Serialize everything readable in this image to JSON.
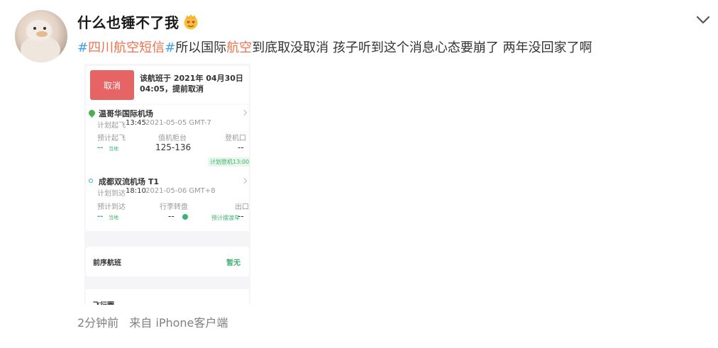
{
  "user": {
    "name": "什么也锤不了我",
    "avatar_icon": "duck-avatar",
    "emoji_icon": "heart-eyes-emoji"
  },
  "post": {
    "hashtag_text": "四川航空短信",
    "text_before_link": "所以国际",
    "link_text": "航空",
    "text_after_link": "到底取没取消 孩子听到这个消息心态要崩了 两年没回家了啊"
  },
  "screenshot": {
    "cancel_button": "取消",
    "cancel_message": "该航班于 2021年 04月30日 04:05，提前取消",
    "departure": {
      "airport": "温哥华国际机场",
      "scheduled_label": "计划起飞",
      "scheduled_time": "13:45",
      "scheduled_date": "2021-05-05 GMT-7",
      "est_label": "预计起飞",
      "counter_label": "值机柜台",
      "gate_label": "登机口",
      "est_value": "--",
      "local_label": "当地",
      "counter_value": "125-136",
      "gate_value": "--",
      "boarding_tag": "计划登机13:00"
    },
    "arrival": {
      "airport": "成都双流机场 T1",
      "scheduled_label": "计划到达",
      "scheduled_time": "18:10",
      "scheduled_date": "2021-05-06 GMT+8",
      "est_label": "预计到达",
      "baggage_label": "行李转盘",
      "exit_label": "出口",
      "est_value": "--",
      "local_label": "当地",
      "baggage_value": "--",
      "exit_tag": "预计摆渡车",
      "exit_value": "--"
    },
    "prev_flight_label": "前序航班",
    "prev_flight_value": "暂无",
    "cut_off_text": "飞行圈"
  },
  "meta": {
    "time": "2分钟前",
    "source": "来自 iPhone客户端"
  },
  "colors": {
    "hashtag": "#eb7350",
    "hash_mark": "#3ea0e6",
    "cancel_red": "#e66464",
    "green": "#3cb371"
  }
}
